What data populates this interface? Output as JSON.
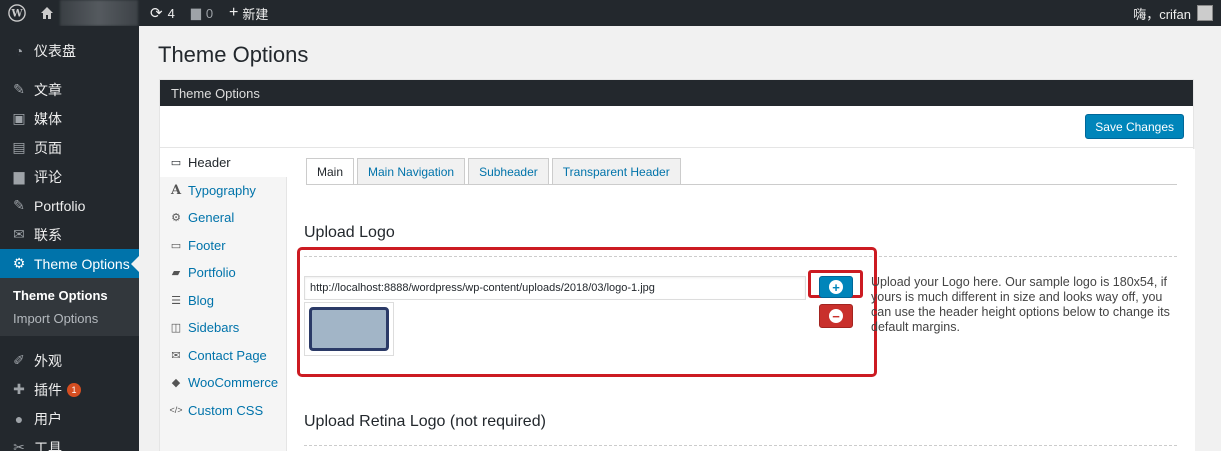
{
  "adminbar": {
    "updates_count": "4",
    "comments_count": "0",
    "new_label": "新建",
    "greeting": "嗨，crifan"
  },
  "sidebar": {
    "items": [
      {
        "label": "仪表盘",
        "icon": "dashboard-icon"
      },
      {
        "label": "文章",
        "icon": "pin-icon"
      },
      {
        "label": "媒体",
        "icon": "media-icon"
      },
      {
        "label": "页面",
        "icon": "page-icon"
      },
      {
        "label": "评论",
        "icon": "comment-icon"
      },
      {
        "label": "Portfolio",
        "icon": "pin-icon"
      },
      {
        "label": "联系",
        "icon": "mail-icon"
      },
      {
        "label": "Theme Options",
        "icon": "gear-icon"
      }
    ],
    "submenu": [
      "Theme Options",
      "Import Options"
    ],
    "lower_items": [
      {
        "label": "外观",
        "icon": "brush-icon"
      },
      {
        "label": "插件",
        "icon": "plugin-icon",
        "badge": "1"
      },
      {
        "label": "用户",
        "icon": "user-icon"
      },
      {
        "label": "工具",
        "icon": "tools-icon"
      }
    ]
  },
  "page": {
    "title": "Theme Options",
    "panel_title": "Theme Options",
    "save_label": "Save Changes"
  },
  "sections": [
    {
      "label": "Header",
      "icon": "monitor-icon"
    },
    {
      "label": "Typography",
      "icon": "typography-icon"
    },
    {
      "label": "General",
      "icon": "gear-icon"
    },
    {
      "label": "Footer",
      "icon": "monitor-icon"
    },
    {
      "label": "Portfolio",
      "icon": "briefcase-icon"
    },
    {
      "label": "Blog",
      "icon": "list-icon"
    },
    {
      "label": "Sidebars",
      "icon": "columns-icon"
    },
    {
      "label": "Contact Page",
      "icon": "mail-icon"
    },
    {
      "label": "WooCommerce",
      "icon": "tag-icon"
    },
    {
      "label": "Custom CSS",
      "icon": "code-icon"
    }
  ],
  "tabs": [
    "Main",
    "Main Navigation",
    "Subheader",
    "Transparent Header"
  ],
  "upload_logo": {
    "heading": "Upload Logo",
    "url_value": "http://localhost:8888/wordpress/wp-content/uploads/2018/03/logo-1.jpg",
    "description": "Upload your Logo here. Our sample logo is 180x54, if yours is much different in size and looks way off, you can use the header height options below to change its default margins."
  },
  "upload_retina": {
    "heading": "Upload Retina Logo (not required)"
  },
  "colors": {
    "accent": "#0073aa",
    "button": "#0085ba",
    "remove": "#c9302c",
    "highlight": "#cc1b22"
  }
}
